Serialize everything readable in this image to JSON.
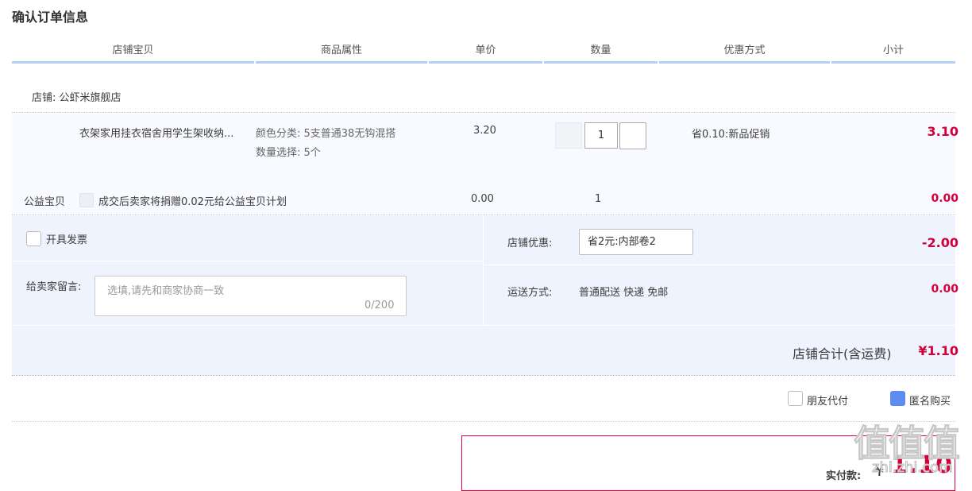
{
  "page": {
    "title": "确认订单信息"
  },
  "table_header": [
    "店铺宝贝",
    "商品属性",
    "单价",
    "数量",
    "优惠方式",
    "小计"
  ],
  "shop": {
    "label": "店铺: 公虾米旗舰店"
  },
  "item": {
    "title": "衣架家用挂衣宿舍用学生架收纳...",
    "sku_color": "颜色分类: 5支普通38无钩混搭",
    "sku_qty": "数量选择: 5个",
    "price": "3.20",
    "quantity": "1",
    "promotion": "省0.10:新品促销",
    "subtotal": "3.10"
  },
  "charity": {
    "label": "公益宝贝",
    "text": "成交后卖家将捐赠0.02元给公益宝贝计划",
    "price": "0.00",
    "quantity": "1",
    "subtotal": "0.00"
  },
  "options": {
    "invoice_label": "开具发票",
    "memo_label": "给卖家留言:",
    "memo_placeholder": "选填,请先和商家协商一致",
    "memo_count": "0/200",
    "discount_label": "店铺优惠:",
    "discount_value": "省2元:内部卷2",
    "discount_amount": "-2.00",
    "shipping_label": "运送方式:",
    "shipping_value": "普通配送 快递 免邮",
    "shipping_amount": "0.00",
    "total_label": "店铺合计(含运费)",
    "total_amount": "¥1.10"
  },
  "extras": {
    "friend_pay_label": "朋友代付",
    "friend_pay_checked": false,
    "anonymous_label": "匿名购买",
    "anonymous_checked": true
  },
  "payment": {
    "label": "实付款:",
    "currency": "¥",
    "amount": "1.10"
  },
  "watermark": {
    "text": "值值值",
    "sub": "zhi.zhi.com"
  },
  "colors": {
    "accent_red": "#d4003a",
    "header_line": "#b2d1f0",
    "panel_bg": "#eef3fd",
    "check_blue": "#5b8cf0"
  }
}
